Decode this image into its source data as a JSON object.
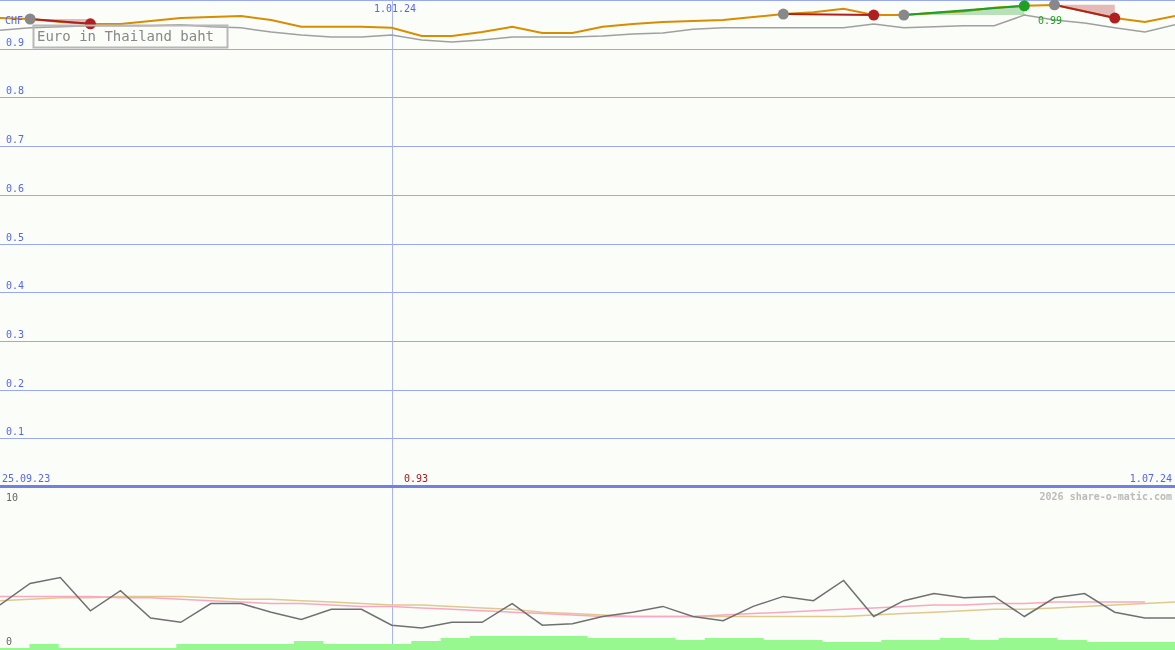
{
  "main_chart": {
    "currency": "CHF",
    "divider_label": "1.01.24",
    "high_label": "0.99",
    "low_label": "0.93",
    "start_date": "25.09.23",
    "end_date": "1.07.24",
    "chart_data": {
      "type": "line",
      "grid": true,
      "categories": [
        null,
        null,
        null,
        null,
        null,
        null,
        null,
        null,
        null,
        null,
        null,
        null,
        null,
        null,
        null,
        null,
        null,
        null,
        null,
        null,
        null,
        null,
        null,
        null,
        null,
        null,
        null,
        null,
        null,
        null,
        null,
        null,
        null,
        null,
        null,
        null,
        null,
        null,
        null,
        null
      ],
      "ylim": [
        0,
        1
      ],
      "yticks": [
        0.1,
        0.2,
        0.3,
        0.4,
        0.5,
        0.6,
        0.7,
        0.8,
        0.9
      ],
      "series": [
        {
          "name": "Euro in Thailand baht",
          "color": "#d88c00",
          "values": [
            0.963,
            0.961,
            0.955,
            0.951,
            0.951,
            0.957,
            0.963,
            0.965,
            0.967,
            0.959,
            0.945,
            0.945,
            0.945,
            0.943,
            0.926,
            0.926,
            0.934,
            0.945,
            0.932,
            0.932,
            0.945,
            0.951,
            0.955,
            0.957,
            0.959,
            0.965,
            0.971,
            0.975,
            0.982,
            0.969,
            0.969,
            0.973,
            0.977,
            0.984,
            0.988,
            0.99,
            0.977,
            0.963,
            0.955,
            0.967
          ]
        },
        {
          "color": "#a0a0a0",
          "values": [
            0.938,
            0.943,
            0.945,
            0.947,
            0.947,
            0.947,
            0.949,
            0.945,
            0.943,
            0.934,
            0.928,
            0.924,
            0.924,
            0.928,
            0.918,
            0.914,
            0.918,
            0.924,
            0.924,
            0.924,
            0.926,
            0.93,
            0.932,
            0.94,
            0.943,
            0.943,
            0.943,
            0.943,
            0.943,
            0.951,
            0.943,
            0.945,
            0.947,
            0.947,
            0.969,
            0.959,
            0.953,
            0.943,
            0.934,
            0.949
          ]
        }
      ]
    }
  },
  "lower_chart": {
    "copyright": "2026 share-o-matic.com",
    "chart_data": {
      "type": "line",
      "ylim": [
        0,
        10
      ],
      "yticks": [
        0,
        10
      ],
      "categories": [
        null,
        null,
        null,
        null,
        null,
        null,
        null,
        null,
        null,
        null,
        null,
        null,
        null,
        null,
        null,
        null,
        null,
        null,
        null,
        null,
        null,
        null,
        null,
        null,
        null,
        null,
        null,
        null,
        null,
        null,
        null,
        null,
        null,
        null,
        null,
        null,
        null,
        null,
        null,
        null
      ],
      "series": [
        {
          "color": "#e0c890",
          "values": [
            2.8,
            2.9,
            3.0,
            3.0,
            3.1,
            3.1,
            3.1,
            3.0,
            2.9,
            2.9,
            2.8,
            2.7,
            2.6,
            2.5,
            2.5,
            2.4,
            2.3,
            2.2,
            2.0,
            1.9,
            1.8,
            1.7,
            1.7,
            1.7,
            1.7,
            1.7,
            1.7,
            1.7,
            1.7,
            1.8,
            1.9,
            2.0,
            2.1,
            2.2,
            2.2,
            2.3,
            2.4,
            2.5,
            2.6,
            2.7
          ]
        },
        {
          "color": "#f8a8c0",
          "values": [
            3.1,
            3.1,
            3.1,
            3.1,
            3.0,
            3.0,
            2.9,
            2.8,
            2.7,
            2.6,
            2.6,
            2.5,
            2.4,
            2.4,
            2.3,
            2.2,
            2.1,
            2.0,
            1.9,
            1.8,
            1.7,
            1.7,
            1.7,
            1.7,
            1.8,
            1.9,
            2.0,
            2.1,
            2.2,
            2.3,
            2.4,
            2.5,
            2.5,
            2.6,
            2.6,
            2.7,
            2.7,
            2.7,
            2.7,
            null
          ]
        },
        {
          "color": "#707070",
          "values": [
            2.5,
            4.0,
            4.4,
            2.1,
            3.5,
            1.6,
            1.3,
            2.6,
            2.6,
            2.0,
            1.5,
            2.2,
            2.2,
            1.1,
            0.9,
            1.3,
            1.3,
            2.6,
            1.1,
            1.2,
            1.7,
            2.0,
            2.4,
            1.7,
            1.4,
            2.4,
            3.1,
            2.8,
            4.2,
            1.7,
            2.8,
            3.3,
            3.0,
            3.1,
            1.7,
            3.0,
            3.3,
            2.0,
            1.6,
            1.6
          ]
        }
      ]
    }
  }
}
